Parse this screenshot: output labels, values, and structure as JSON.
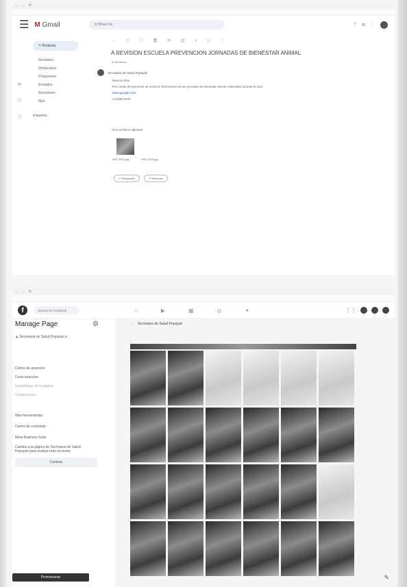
{
  "gmail": {
    "app": "Gmail",
    "search_text": "Q Wheel fat",
    "compose_label": "Redactar",
    "nav_items": [
      "Recibidos",
      "Destacados",
      "Pospuestos",
      "Enviados",
      "Borradores",
      "Más"
    ],
    "labels_heading": "Etiquetas",
    "subject": "A REVISION ESCUELA PREVENCION JORNADAS DE BIENESTAR ANIMAL",
    "inbox_chip": "Recibidos",
    "sender": "Secretaria de Salud Popayán",
    "greeting": "Buenos días",
    "body_text": "Por medio del presente se envía la información de las jornadas de bienestar animal realizadas durante el mes",
    "link_text": "drive.google.com",
    "closing": "Cordialmente",
    "attachments_heading": "Dos archivos adjuntos",
    "file_1": "IMG-2024.jpg",
    "file_2": "IMG-2024.jpg",
    "reply_label": "Responder",
    "forward_label": "Reenviar"
  },
  "facebook": {
    "search_placeholder": "Buscar en Facebook",
    "manage_title": "Manage Page",
    "page_name": "Secretaría de Salud Popayán",
    "side_items": [
      "Centro de anuncios",
      "Crear anuncios",
      "Estadísticas de la página",
      "Configuración"
    ],
    "more_tools": "Más herramientas",
    "creator_studio": "Centro de contenido",
    "meta_suite": "Meta Business Suite",
    "switch_text": "Cambia a la página de Secretaría de Salud Popayán para realizar más acciones",
    "switch_button": "Cambiar",
    "promote_button": "Promocionar",
    "album_title": "Secretaría de Salud Popayán"
  }
}
